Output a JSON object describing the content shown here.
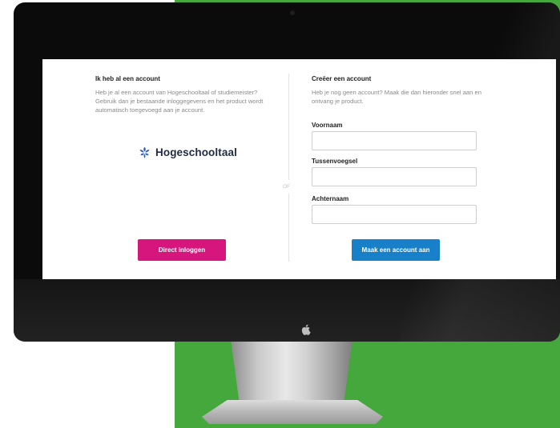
{
  "login": {
    "heading": "Ik heb al een account",
    "description": "Heb je al een account van Hogeschooltaal of studiemeister? Gebruik dan je bestaande inloggegevens en het product wordt automatisch toegevoegd aan je account.",
    "logo_text": "Hogeschooltaal",
    "button_label": "Direct inloggen"
  },
  "divider": {
    "label": "OF"
  },
  "register": {
    "heading": "Creëer een account",
    "description": "Heb je nog geen account? Maak die dan hieronder snel aan en ontvang je product.",
    "fields": [
      {
        "label": "Voornaam",
        "value": "",
        "placeholder": ""
      },
      {
        "label": "Tussenvoegsel",
        "value": "",
        "placeholder": ""
      },
      {
        "label": "Achternaam",
        "value": "",
        "placeholder": ""
      }
    ],
    "button_label": "Maak een account aan"
  },
  "colors": {
    "background_green": "#44a83c",
    "login_button": "#d6167c",
    "register_button": "#1880c8",
    "logo_blue": "#1f2a44"
  }
}
